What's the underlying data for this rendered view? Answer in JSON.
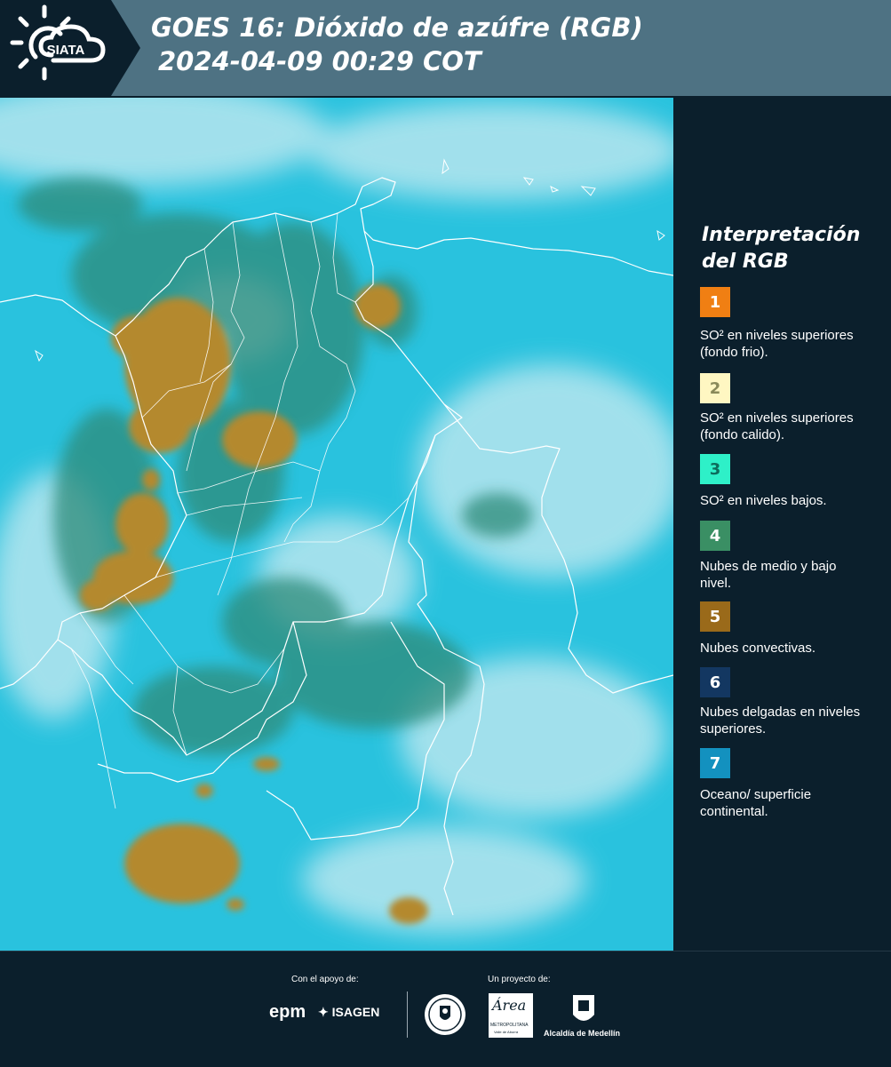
{
  "header": {
    "brand": "SIATA",
    "title_line1": "GOES 16: Dióxido de azúfre (RGB)",
    "title_line2": "2024-04-09 00:29 COT"
  },
  "legend": {
    "title_line1": "Interpretación",
    "title_line2": "del RGB",
    "items": [
      {
        "number": "1",
        "text": "SO² en niveles superiores (fondo frio).",
        "color": "#f07f13",
        "number_color": "#ffffff"
      },
      {
        "number": "2",
        "text": "SO² en niveles superiores (fondo calido).",
        "color": "#fff7c2",
        "number_color": "#8a8a5a"
      },
      {
        "number": "3",
        "text": "SO² en niveles bajos.",
        "color": "#2ef0c8",
        "number_color": "#0d6c5c"
      },
      {
        "number": "4",
        "text": "Nubes de medio y bajo nivel.",
        "color": "#3a8f64",
        "number_color": "#ffffff"
      },
      {
        "number": "5",
        "text": "Nubes convectivas.",
        "color": "#9a6a1a",
        "number_color": "#ffffff"
      },
      {
        "number": "6",
        "text": "Nubes delgadas en niveles superiores.",
        "color": "#133761",
        "number_color": "#ffffff"
      },
      {
        "number": "7",
        "text": "Oceano/ superficie continental.",
        "color": "#1391bf",
        "number_color": "#ffffff"
      }
    ]
  },
  "footer": {
    "support_label": "Con el apoyo de:",
    "project_label": "Un proyecto de:",
    "epm": "epm",
    "isagen": "ISAGEN",
    "metropolitana_big": "Área",
    "metropolitana": "METROPOLITANA",
    "metropolitana_sub": "Valle de Aburrá",
    "alcaldia": "Alcaldía de Medellín"
  },
  "colors": {
    "header_bg": "#4e7283",
    "logo_tab_bg": "#0b1f2c",
    "page_bg": "#0b1f2c",
    "map_cyan": "#29c2de",
    "map_cloud": "#b7e6ef",
    "map_green": "#2f8b79",
    "map_convective": "#b4892d"
  }
}
